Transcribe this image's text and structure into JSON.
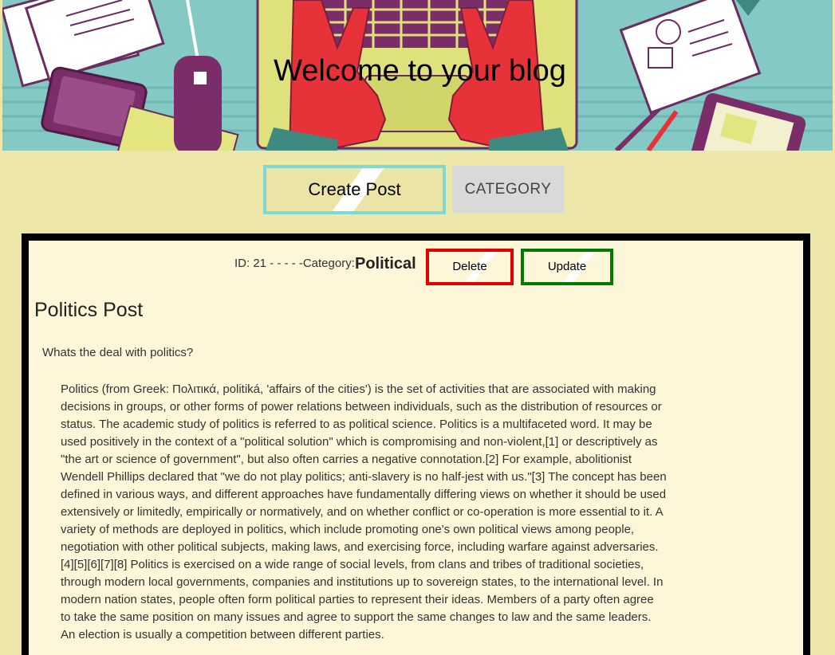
{
  "hero": {
    "title": "Welcome to your blog"
  },
  "nav": {
    "create_label": "Create Post",
    "category_label": "CATEGORY"
  },
  "post": {
    "meta": "ID: 21 - - - - -Category: -",
    "category": "Political",
    "delete_label": "Delete",
    "update_label": "Update",
    "title": "Politics Post",
    "question": "Whats the deal with politics?",
    "body": "Politics (from Greek: Πολιτικά, politiká, 'affairs of the cities') is the set of activities that are associated with making decisions in groups, or other forms of power relations between individuals, such as the distribution of resources or status. The academic study of politics is referred to as political science. Politics is a multifaceted word. It may be used positively in the context of a \"political solution\" which is compromising and non-violent,[1] or descriptively as \"the art or science of government\", but also often carries a negative connotation.[2] For example, abolitionist Wendell Phillips declared that \"we do not play politics; anti-slavery is no half-jest with us.\"[3] The concept has been defined in various ways, and different approaches have fundamentally differing views on whether it should be used extensively or limitedly, empirically or normatively, and on whether conflict or co-operation is more essential to it. A variety of methods are deployed in politics, which include promoting one's own political views among people, negotiation with other political subjects, making laws, and exercising force, including warfare against adversaries.[4][5][6][7][8] Politics is exercised on a wide range of social levels, from clans and tribes of traditional societies, through modern local governments, companies and institutions up to sovereign states, to the international level. In modern nation states, people often form political parties to represent their ideas. Members of a party often agree to take the same position on many issues and agree to support the same changes to law and the same leaders. An election is usually a competition between different parties."
  },
  "colors": {
    "page_bg": "#ede7a9",
    "post_bg": "#fdf6d8",
    "create_border": "#7fd8d2",
    "delete_border": "#e00000",
    "update_border": "#007a00",
    "hero_bg": "#84c9c4"
  }
}
